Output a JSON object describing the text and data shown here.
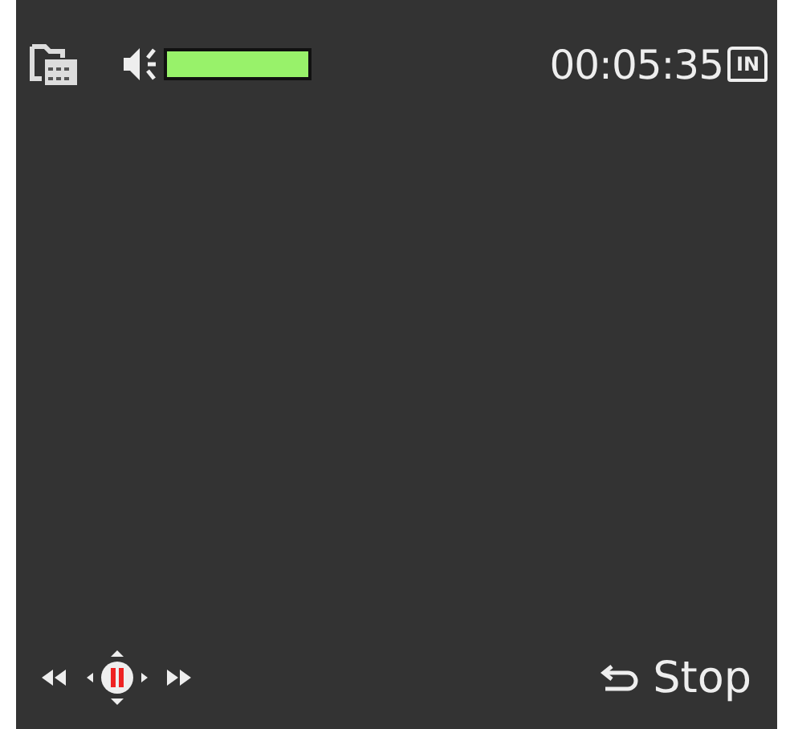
{
  "status_bar": {
    "volume": {
      "level": 1
    },
    "time": "00:05:35",
    "source_badge": "IN"
  },
  "footer": {
    "stop_label": "Stop"
  }
}
